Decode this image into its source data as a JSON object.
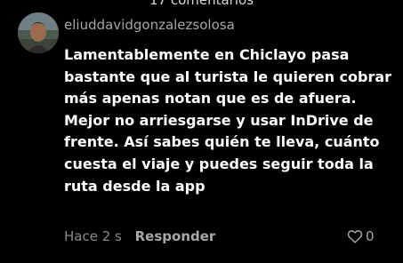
{
  "header": {
    "comment_count": "17 comentarios"
  },
  "comment": {
    "username": "eliuddavidgonzalezsolosa",
    "lines": [
      "Lamentablemente en Chiclayo pasa",
      "bastante que al turista le quieren cobrar",
      "más apenas notan que es de afuera.",
      "Mejor no arriesgarse y usar InDrive de",
      "frente. Así sabes quién te lleva, cuánto",
      "cuesta el viaje y puedes seguir toda la",
      "ruta desde la app"
    ],
    "time": "Hace 2 s",
    "reply_label": "Responder",
    "like_count": "0",
    "like_icon": "heart-outline-icon",
    "avatar_icon": "user-avatar"
  },
  "colors": {
    "background": "#000000",
    "text_primary": "#ffffff",
    "text_secondary": "#a6a6a6"
  }
}
